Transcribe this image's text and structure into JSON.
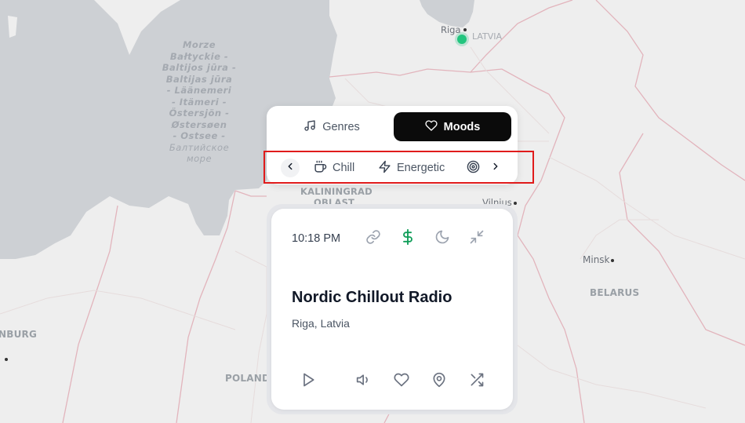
{
  "map": {
    "sea_label_lines": [
      "Morze",
      "Bałtyckie -",
      "Baltijos jūra -",
      "Baltijas jūra",
      "- Läänemeri",
      "- Itämeri -",
      "Östersjön -",
      "Østersøen",
      "- Ostsee -"
    ],
    "sea_label_cyrillic": [
      "Балтийское",
      "море"
    ],
    "places": {
      "riga": "Riga",
      "latvia": "LATVIA",
      "kaliningrad_line1": "KALININGRAD",
      "kaliningrad_line2": "OBLAST",
      "vilnius": "Vilnius",
      "minsk": "Minsk",
      "belarus": "BELARUS",
      "poland": "POLAND",
      "burg_fragment": "NBURG"
    },
    "colors": {
      "water": "#cdd0d4",
      "land": "#eeeeee",
      "border": "#e2b4bc",
      "marker": "#22c57e"
    }
  },
  "tabs": {
    "genres": {
      "label": "Genres",
      "icon": "music-note-icon"
    },
    "moods": {
      "label": "Moods",
      "icon": "heart-icon"
    }
  },
  "moods": {
    "prev_icon": "chevron-left-icon",
    "next_icon": "chevron-right-icon",
    "items": [
      {
        "label": "Chill",
        "icon": "coffee-cup-icon"
      },
      {
        "label": "Energetic",
        "icon": "lightning-icon"
      },
      {
        "label": "",
        "icon": "target-icon"
      }
    ]
  },
  "player": {
    "time": "10:18 PM",
    "station_name": "Nordic Chillout Radio",
    "location": "Riga, Latvia",
    "top_icons": [
      "link-icon",
      "dollar-icon",
      "moon-icon",
      "minimize-icon"
    ],
    "bottom_icons": [
      "play-icon",
      "volume-icon",
      "heart-icon",
      "map-pin-icon",
      "shuffle-icon"
    ],
    "accent_color": "#0f9d58"
  }
}
